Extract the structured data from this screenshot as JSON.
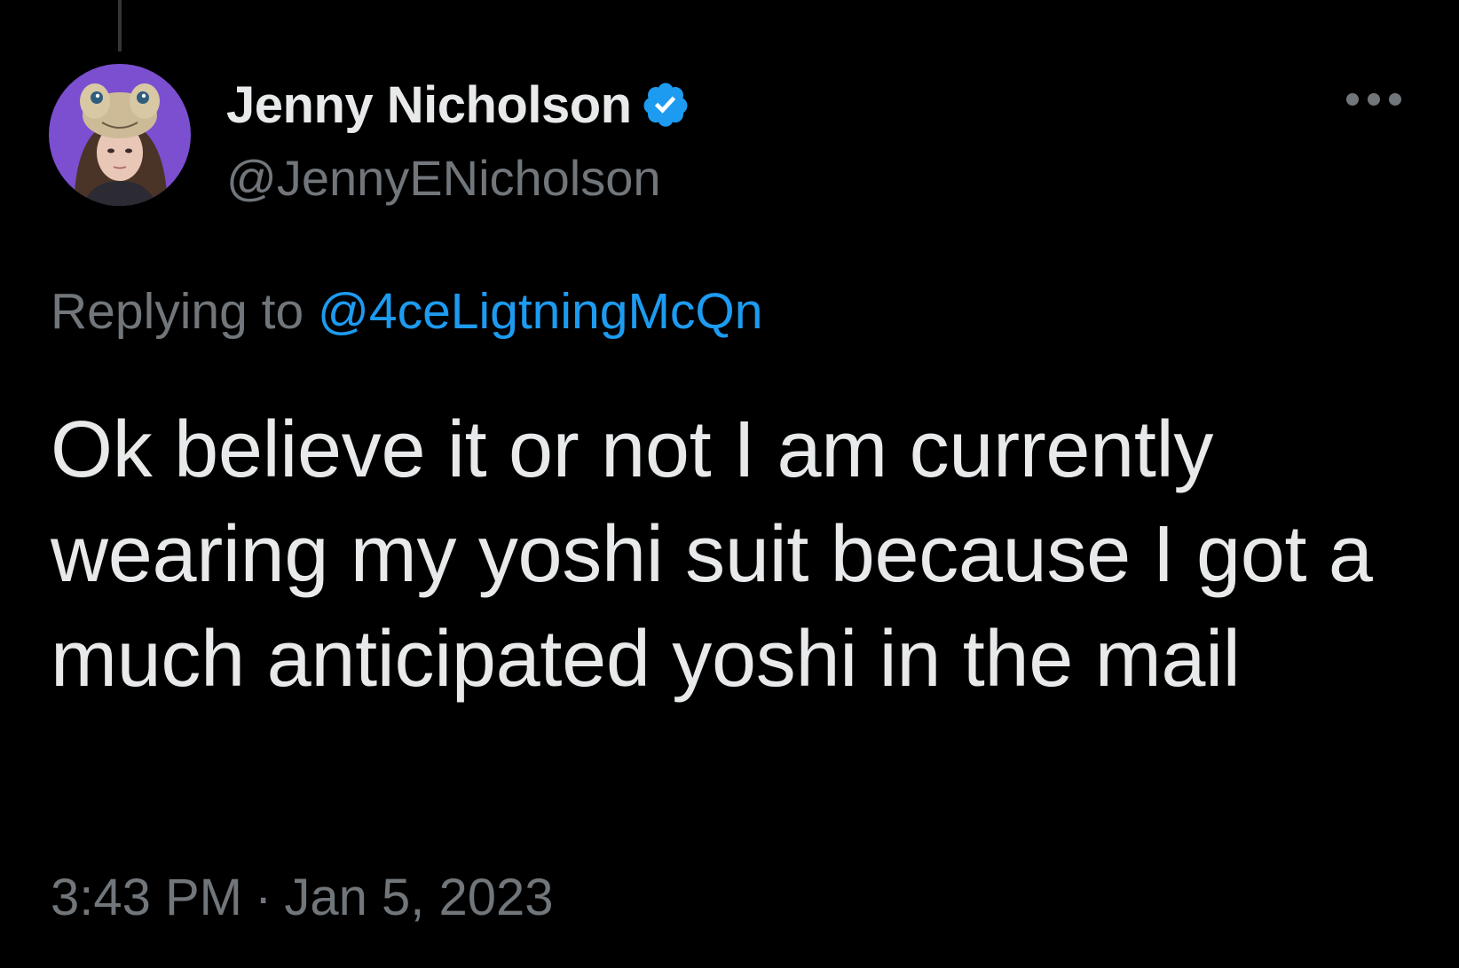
{
  "tweet": {
    "author": {
      "display_name": "Jenny Nicholson",
      "handle": "@JennyENicholson",
      "verified": true
    },
    "reply": {
      "prefix": "Replying to",
      "mention": "@4ceLigtningMcQn"
    },
    "text": "Ok believe it or not I am currently wearing my yoshi suit because I got a much anticipated yoshi in the mail",
    "time": "3:43 PM",
    "separator": "·",
    "date": "Jan 5, 2023"
  },
  "icons": {
    "verified": "verified-badge-icon",
    "more": "more-options-icon"
  },
  "colors": {
    "background": "#000000",
    "primary_text": "#e7e9ea",
    "secondary_text": "#71767b",
    "accent": "#1d9bf0",
    "avatar_bg": "#7b4fd0"
  }
}
